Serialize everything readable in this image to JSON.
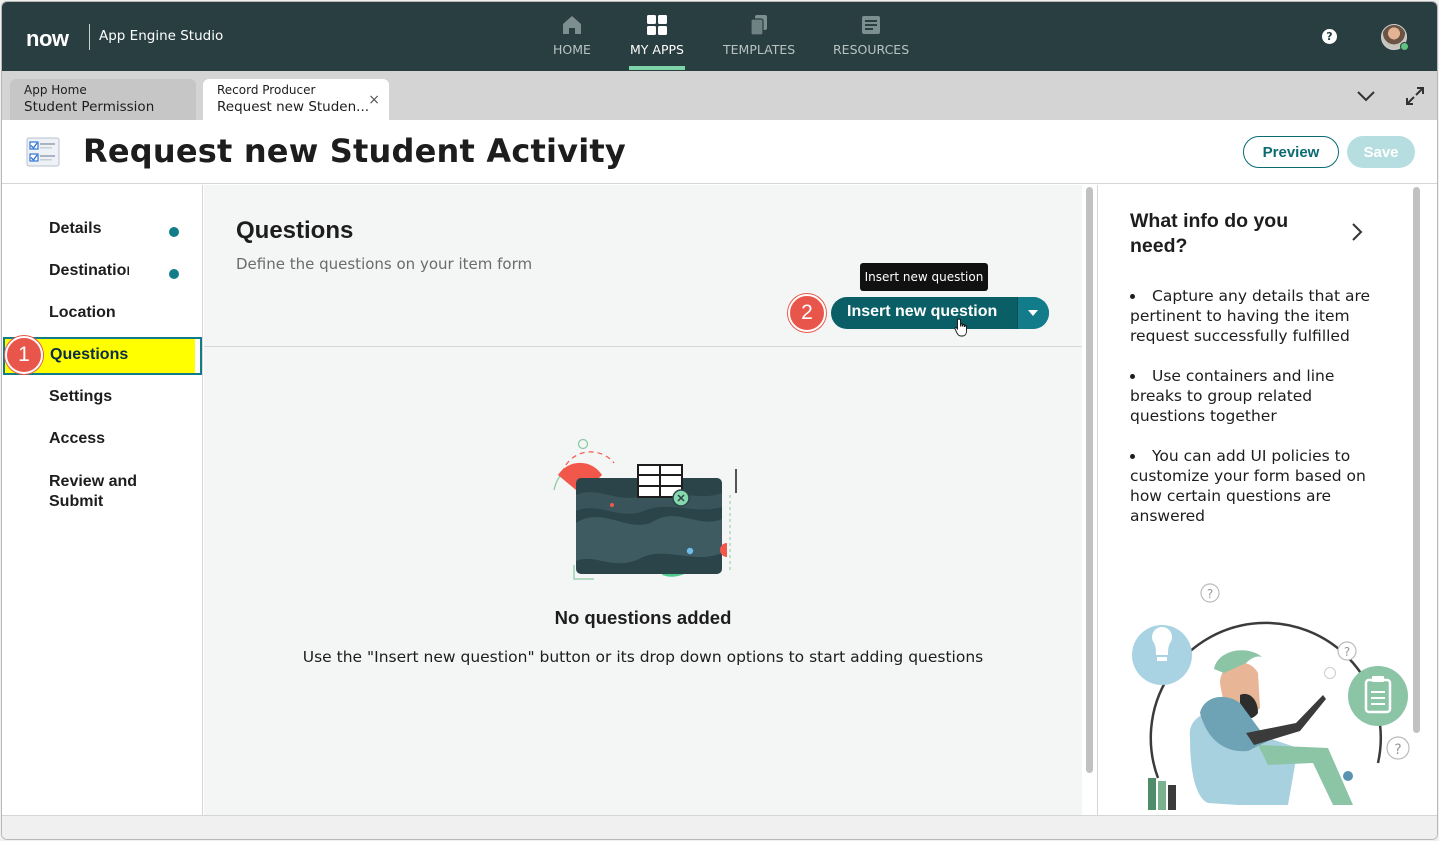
{
  "topnav": {
    "logo": "now",
    "app_title": "App Engine Studio",
    "items": [
      {
        "label": "HOME",
        "icon": "home-icon"
      },
      {
        "label": "MY APPS",
        "icon": "grid-icon",
        "active": true
      },
      {
        "label": "TEMPLATES",
        "icon": "templates-icon"
      },
      {
        "label": "RESOURCES",
        "icon": "resources-icon"
      }
    ],
    "help": "?",
    "accent_color": "#7ed3a8",
    "bg_color": "#293e40"
  },
  "tabs": [
    {
      "type": "App Home",
      "name": "Student Permission",
      "active": false
    },
    {
      "type": "Record Producer",
      "name": "Request new Studen...",
      "active": true,
      "close": "×"
    }
  ],
  "header": {
    "title": "Request new Student Activity",
    "preview_label": "Preview",
    "save_label": "Save"
  },
  "steps": [
    {
      "label": "Details",
      "completed": true
    },
    {
      "label": "Destination",
      "completed": true
    },
    {
      "label": "Location",
      "completed": false
    },
    {
      "label": "Questions",
      "completed": false,
      "selected": true
    },
    {
      "label": "Settings",
      "completed": false
    },
    {
      "label": "Access",
      "completed": false
    },
    {
      "label": "Review and Submit",
      "completed": false
    }
  ],
  "annotations": {
    "step1": "1",
    "step2": "2",
    "badge_color": "#e8564b"
  },
  "questions": {
    "title": "Questions",
    "subtitle": "Define the questions on your item form",
    "tooltip": "Insert new question",
    "insert_label": "Insert new question",
    "empty_title": "No questions added",
    "empty_desc": "Use the \"Insert new question\" button or its drop down options to start adding questions"
  },
  "help_panel": {
    "title": "What info do you need?",
    "tips": [
      "Capture any details that are pertinent to having the item request successfully fulfilled",
      "Use containers and line breaks to group related questions together",
      "You can add UI policies to customize your form based on how certain questions are answered"
    ]
  }
}
